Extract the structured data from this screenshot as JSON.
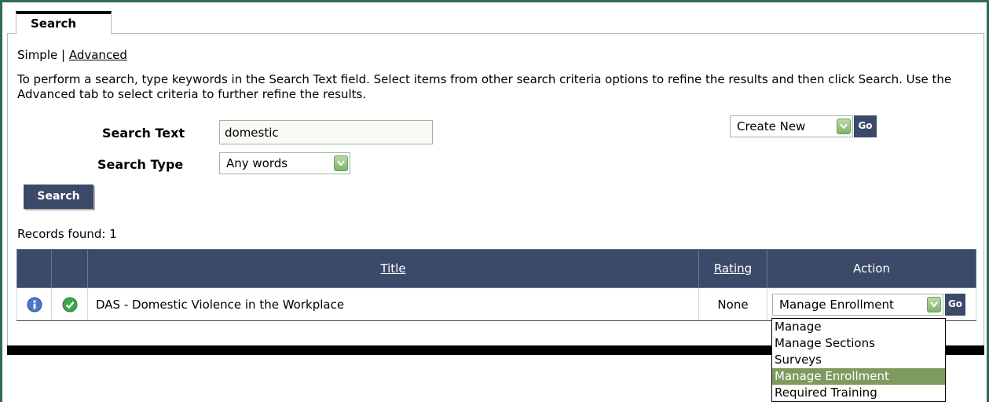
{
  "tab": {
    "label": "Search"
  },
  "modes": {
    "simple": "Simple",
    "separator": "|",
    "advanced": "Advanced"
  },
  "description": "To perform a search, type keywords in the Search Text field. Select items from other search criteria options to refine the results and then click Search. Use the Advanced tab to select criteria to further refine the results.",
  "form": {
    "search_text_label": "Search Text",
    "search_text_value": "domestic",
    "search_type_label": "Search Type",
    "search_type_value": "Any words",
    "search_button": "Search"
  },
  "create_new": {
    "value": "Create New",
    "go": "Go"
  },
  "records_found": "Records found: 1",
  "table": {
    "headers": {
      "title": "Title",
      "rating": "Rating",
      "action": "Action"
    },
    "rows": [
      {
        "title": "DAS - Domestic Violence in the Workplace",
        "rating": "None",
        "action": "Manage Enrollment",
        "go": "Go"
      }
    ]
  },
  "action_menu": {
    "options": [
      "Manage",
      "Manage Sections",
      "Surveys",
      "Manage Enrollment",
      "Required Training"
    ],
    "selected_index": 3
  },
  "colors": {
    "frame": "#2f6b52",
    "header_bg": "#3b4a68",
    "selected_option": "#7f9a5f",
    "dropdown_arrow": "#7fb36a"
  }
}
